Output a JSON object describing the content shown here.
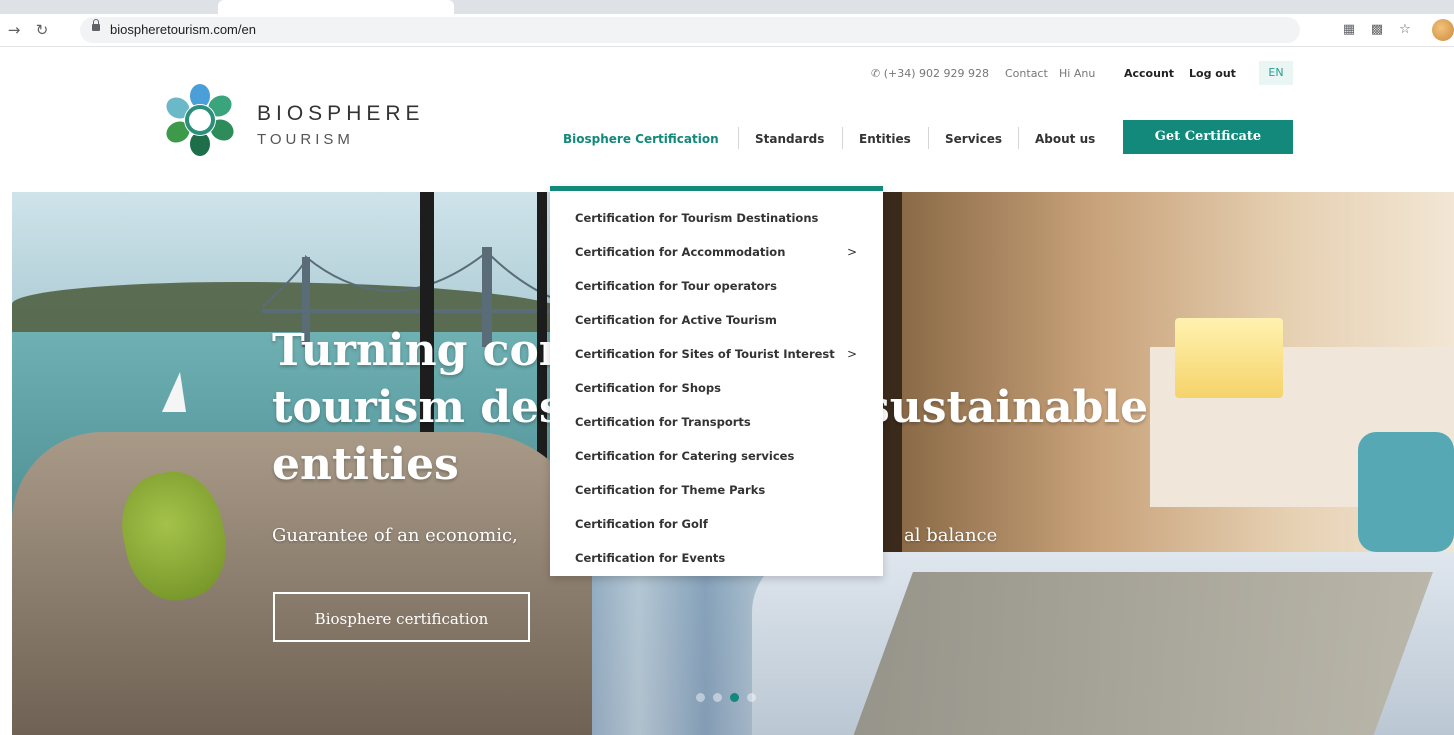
{
  "browser": {
    "url": "biospheretourism.com/en",
    "icons": [
      "back-arrow-icon",
      "reload-icon",
      "lock-icon",
      "extension-icon",
      "translate-icon",
      "star-icon",
      "profile-avatar"
    ]
  },
  "brand": {
    "name_line1": "BIOSPHERE",
    "name_line2": "TOURISM"
  },
  "topbar": {
    "phone": "✆ (+34) 902 929 928",
    "contact": "Contact",
    "greeting": "Hi Anu",
    "account": "Account",
    "logout": "Log out",
    "language": "EN"
  },
  "nav": {
    "items": [
      {
        "label": "Biosphere Certification",
        "active": true
      },
      {
        "label": "Standards"
      },
      {
        "label": "Entities"
      },
      {
        "label": "Services"
      },
      {
        "label": "About us"
      }
    ],
    "cta": "Get Certificate"
  },
  "dropdown": {
    "items": [
      {
        "label": "Certification for Tourism Destinations"
      },
      {
        "label": "Certification for Accommodation",
        "arrow": ">"
      },
      {
        "label": "Certification for Tour operators"
      },
      {
        "label": "Certification for Active Tourism"
      },
      {
        "label": "Certification for Sites of Tourist Interest",
        "arrow": ">"
      },
      {
        "label": "Certification for Shops"
      },
      {
        "label": "Certification for Transports"
      },
      {
        "label": "Certification for Catering services"
      },
      {
        "label": "Certification for Theme Parks"
      },
      {
        "label": "Certification for Golf"
      },
      {
        "label": "Certification for Events"
      }
    ]
  },
  "hero": {
    "title_line1": "Turning com",
    "title_line2": "tourism des",
    "title_line2b": "sustainable",
    "title_line3": "entities",
    "subtitle_a": "Guarantee of an economic,",
    "subtitle_b": "al balance",
    "button": "Biosphere certification",
    "active_slide": 3
  },
  "colors": {
    "accent": "#12897a"
  }
}
